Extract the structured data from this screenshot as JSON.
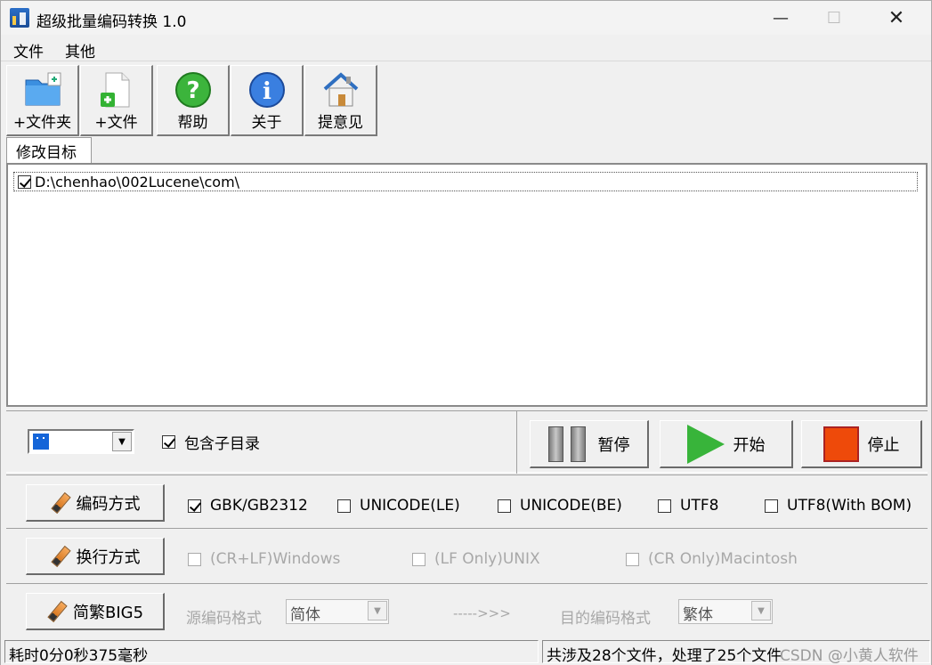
{
  "window": {
    "title": "超级批量编码转换 1.0",
    "minimize_glyph": "—",
    "maximize_glyph": "☐",
    "close_glyph": "✕"
  },
  "menu": {
    "items": [
      {
        "label": "文件"
      },
      {
        "label": "其他"
      }
    ]
  },
  "toolbar": {
    "buttons": [
      {
        "label": "+文件夹",
        "icon": "folder-add-icon"
      },
      {
        "label": "+文件",
        "icon": "file-add-icon"
      },
      {
        "label": "帮助",
        "icon": "help-icon"
      },
      {
        "label": "关于",
        "icon": "info-icon"
      },
      {
        "label": "提意见",
        "icon": "house-icon"
      }
    ]
  },
  "tab": {
    "label": "修改目标"
  },
  "target_list": {
    "items": [
      {
        "checked": true,
        "path": "D:\\chenhao\\002Lucene\\com\\"
      }
    ]
  },
  "controls": {
    "color_select": {
      "swatch_color": "#1565d8",
      "arrow": "▼"
    },
    "include_subdirs": {
      "label": "包含子目录",
      "checked": true
    },
    "pause_label": "暂停",
    "start_label": "开始",
    "stop_label": "停止",
    "colors": {
      "play": "#38b43a",
      "stop": "#ee4a0a"
    }
  },
  "encoding": {
    "button_label": "编码方式",
    "options": [
      {
        "label": "GBK/GB2312",
        "checked": true
      },
      {
        "label": "UNICODE(LE)",
        "checked": false
      },
      {
        "label": "UNICODE(BE)",
        "checked": false
      },
      {
        "label": "UTF8",
        "checked": false
      },
      {
        "label": "UTF8(With BOM)",
        "checked": false
      }
    ]
  },
  "line_ending": {
    "button_label": "换行方式",
    "options": [
      {
        "label": "(CR+LF)Windows",
        "checked": false
      },
      {
        "label": "(LF Only)UNIX",
        "checked": false
      },
      {
        "label": "(CR Only)Macintosh",
        "checked": false
      }
    ]
  },
  "big5": {
    "button_label": "简繁BIG5",
    "source_label": "源编码格式",
    "source_value": "简体",
    "arrow_text": "----->>>",
    "target_label": "目的编码格式",
    "target_value": "繁体",
    "arrow": "▼"
  },
  "status": {
    "elapsed": "耗时0分0秒375毫秒",
    "summary": "共涉及28个文件，处理了25个文件",
    "watermark": "CSDN @小黄人软件"
  }
}
